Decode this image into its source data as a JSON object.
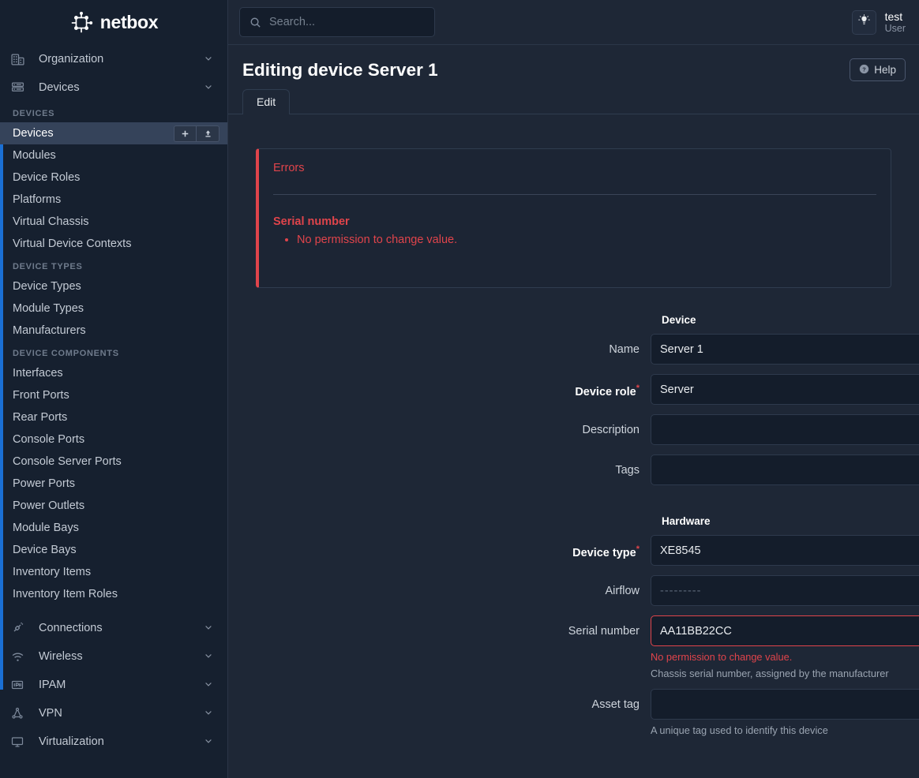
{
  "brand": {
    "name": "netbox",
    "logo_icon": "netbox-logo-icon"
  },
  "search": {
    "placeholder": "Search...",
    "value": "",
    "icon": "search-icon"
  },
  "topbar": {
    "theme_toggle_icon": "lightbulb-icon",
    "user_name": "test",
    "user_role": "User"
  },
  "page": {
    "title": "Editing device Server 1",
    "help_label": "Help",
    "help_icon": "question-circle-icon"
  },
  "tabs": [
    {
      "label": "Edit",
      "active": true
    }
  ],
  "errors": {
    "title": "Errors",
    "field_label": "Serial number",
    "messages": [
      "No permission to change value."
    ]
  },
  "sidebar": {
    "groups": [
      {
        "label": "Organization",
        "icon": "building-icon",
        "chevron": "chevron-down-icon",
        "expanded": false
      },
      {
        "label": "Devices",
        "icon": "server-rack-icon",
        "chevron": "chevron-down-icon",
        "expanded": true
      }
    ],
    "sections": [
      {
        "heading": "DEVICES",
        "items": [
          {
            "label": "Devices",
            "active": true,
            "add_icon": "plus-icon",
            "import_icon": "upload-icon"
          },
          {
            "label": "Modules",
            "active": false
          },
          {
            "label": "Device Roles",
            "active": false
          },
          {
            "label": "Platforms",
            "active": false
          },
          {
            "label": "Virtual Chassis",
            "active": false
          },
          {
            "label": "Virtual Device Contexts",
            "active": false
          }
        ]
      },
      {
        "heading": "DEVICE TYPES",
        "items": [
          {
            "label": "Device Types",
            "active": false
          },
          {
            "label": "Module Types",
            "active": false
          },
          {
            "label": "Manufacturers",
            "active": false
          }
        ]
      },
      {
        "heading": "DEVICE COMPONENTS",
        "items": [
          {
            "label": "Interfaces",
            "active": false
          },
          {
            "label": "Front Ports",
            "active": false
          },
          {
            "label": "Rear Ports",
            "active": false
          },
          {
            "label": "Console Ports",
            "active": false
          },
          {
            "label": "Console Server Ports",
            "active": false
          },
          {
            "label": "Power Ports",
            "active": false
          },
          {
            "label": "Power Outlets",
            "active": false
          },
          {
            "label": "Module Bays",
            "active": false
          },
          {
            "label": "Device Bays",
            "active": false
          },
          {
            "label": "Inventory Items",
            "active": false
          },
          {
            "label": "Inventory Item Roles",
            "active": false
          }
        ]
      }
    ],
    "bottom_groups": [
      {
        "label": "Connections",
        "icon": "plug-icon",
        "chevron": "chevron-down-icon"
      },
      {
        "label": "Wireless",
        "icon": "wifi-icon",
        "chevron": "chevron-down-icon"
      },
      {
        "label": "IPAM",
        "icon": "ip-address-icon",
        "chevron": "chevron-down-icon"
      },
      {
        "label": "VPN",
        "icon": "vpn-tunnel-icon",
        "chevron": "chevron-down-icon"
      },
      {
        "label": "Virtualization",
        "icon": "monitor-icon",
        "chevron": "chevron-down-icon"
      }
    ]
  },
  "form": {
    "sections": [
      {
        "title": "Device"
      },
      {
        "title": "Hardware"
      }
    ],
    "fields": {
      "name": {
        "label": "Name",
        "value": "Server 1",
        "required": false
      },
      "device_role": {
        "label": "Device role",
        "value": "Server",
        "required": true,
        "chevron": "chevron-down-icon"
      },
      "description": {
        "label": "Description",
        "value": "",
        "required": false
      },
      "tags": {
        "label": "Tags",
        "value": "",
        "required": false,
        "chevron": "chevron-down-icon"
      },
      "device_type": {
        "label": "Device type",
        "value": "XE8545",
        "required": true,
        "chevron": "chevron-down-icon",
        "lookup_icon": "database-search-icon"
      },
      "airflow": {
        "label": "Airflow",
        "placeholder": "---------",
        "value": "",
        "required": false,
        "chevron": "chevron-down-icon"
      },
      "serial_number": {
        "label": "Serial number",
        "value": "AA11BB22CC",
        "required": false,
        "invalid": true,
        "error": "No permission to change value.",
        "help": "Chassis serial number, assigned by the manufacturer"
      },
      "asset_tag": {
        "label": "Asset tag",
        "value": "",
        "required": false,
        "help": "A unique tag used to identify this device"
      }
    }
  },
  "colors": {
    "accent_blue": "#1a6fd4",
    "error_red": "#e0444b",
    "page_bg": "#1e2736",
    "sidebar_bg": "#16202f",
    "input_bg": "#141d2b"
  }
}
